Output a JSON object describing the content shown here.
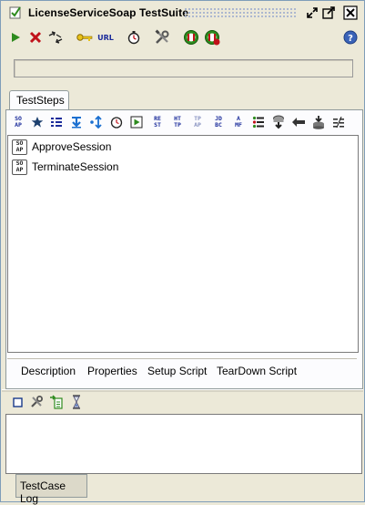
{
  "window": {
    "title": "LicenseServiceSoap TestSuite",
    "controls": [
      "restore-icon",
      "maximize-icon",
      "close-icon"
    ]
  },
  "toolbar": {
    "buttons": [
      {
        "icon": "run-icon"
      },
      {
        "icon": "cancel-icon"
      },
      {
        "icon": "loop-icon"
      },
      {
        "icon": "key-icon"
      },
      {
        "icon": "url-icon",
        "label": "URL"
      },
      {
        "icon": "stopwatch-icon"
      },
      {
        "icon": "tools-icon"
      },
      {
        "icon": "load-test-icon"
      },
      {
        "icon": "load-test-add-icon"
      },
      {
        "icon": "help-icon"
      }
    ]
  },
  "main_tabs": [
    {
      "label": "TestSteps",
      "selected": true
    }
  ],
  "steps_toolbar": {
    "buttons": [
      {
        "icon": "soap-request-icon",
        "label": "SO AP"
      },
      {
        "icon": "star-icon"
      },
      {
        "icon": "properties-icon"
      },
      {
        "icon": "property-transfer-icon"
      },
      {
        "icon": "conditional-goto-icon"
      },
      {
        "icon": "delay-icon"
      },
      {
        "icon": "run-testcase-icon"
      },
      {
        "icon": "rest-request-icon",
        "label": "RE ST"
      },
      {
        "icon": "http-request-icon",
        "label": "HT TP"
      },
      {
        "icon": "amf-disabled-icon",
        "label": "TP AP"
      },
      {
        "icon": "jdbc-request-icon",
        "label": "JD BC"
      },
      {
        "icon": "amf-request-icon",
        "label": "A MF"
      },
      {
        "icon": "list-icon"
      },
      {
        "icon": "mock-response-icon"
      },
      {
        "icon": "back-icon"
      },
      {
        "icon": "database-icon"
      },
      {
        "icon": "compare-icon"
      }
    ]
  },
  "test_steps": [
    {
      "name": "ApproveSession",
      "type": "SO AP"
    },
    {
      "name": "TerminateSession",
      "type": "SO AP"
    }
  ],
  "bottom_tabs": [
    "Description",
    "Properties",
    "Setup Script",
    "TearDown Script"
  ],
  "log": {
    "toolbar_icons": [
      "clear-icon",
      "settings-icon",
      "export-icon",
      "hourglass-icon"
    ],
    "tab_label": "TestCase Log"
  },
  "colors": {
    "accent_green": "#2e8b1e",
    "cancel_red": "#c0121a",
    "link_blue": "#1a2b9a",
    "window_bg": "#ece9d8"
  }
}
